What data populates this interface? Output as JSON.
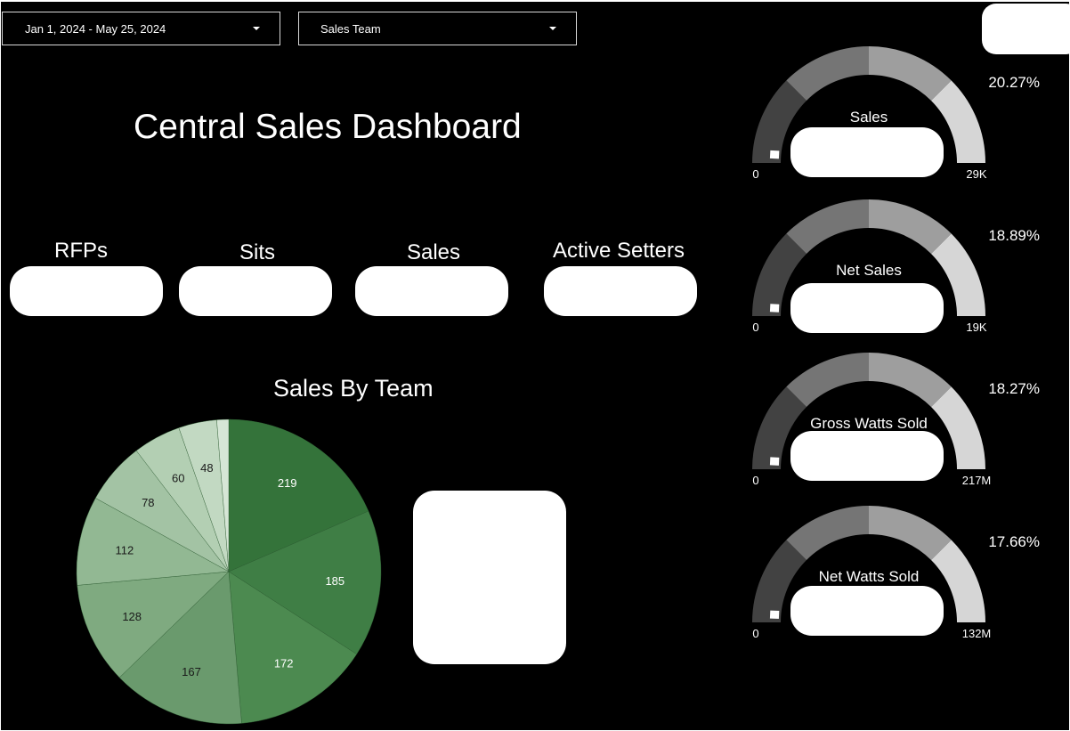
{
  "filters": {
    "date_range": "Jan 1, 2024 - May 25, 2024",
    "team": "Sales Team"
  },
  "dashboard": {
    "title": "Central Sales Dashboard"
  },
  "kpis": [
    {
      "label": "RFPs"
    },
    {
      "label": "Sits"
    },
    {
      "label": "Sales"
    },
    {
      "label": "Active Setters"
    }
  ],
  "gauges": [
    {
      "label": "Sales",
      "percent_text": "20.27%",
      "min": "0",
      "max": "29K",
      "percent": 20.27
    },
    {
      "label": "Net Sales",
      "percent_text": "18.89%",
      "min": "0",
      "max": "19K",
      "percent": 18.89
    },
    {
      "label": "Gross Watts Sold",
      "percent_text": "18.27%",
      "min": "0",
      "max": "217M",
      "percent": 18.27
    },
    {
      "label": "Net Watts Sold",
      "percent_text": "17.66%",
      "min": "0",
      "max": "132M",
      "percent": 17.66
    }
  ],
  "colors": {
    "background": "#000000",
    "gauge_band_1": "#424242",
    "gauge_band_2": "#757575",
    "gauge_band_3": "#9e9e9e",
    "gauge_band_4": "#d6d6d6",
    "pie_shades": [
      "#34733a",
      "#3f7e45",
      "#4c8a50",
      "#6a9a6d",
      "#7faa80",
      "#92b893",
      "#a3c3a4",
      "#b3cfb3",
      "#c2d9c2",
      "#d6e6d6"
    ]
  },
  "chart_data": {
    "type": "pie",
    "title": "Sales By Team",
    "values": [
      219,
      185,
      172,
      167,
      128,
      112,
      78,
      60,
      48,
      15
    ],
    "labels": [
      "219",
      "185",
      "172",
      "167",
      "128",
      "112",
      "78",
      "60",
      "48",
      ""
    ]
  }
}
